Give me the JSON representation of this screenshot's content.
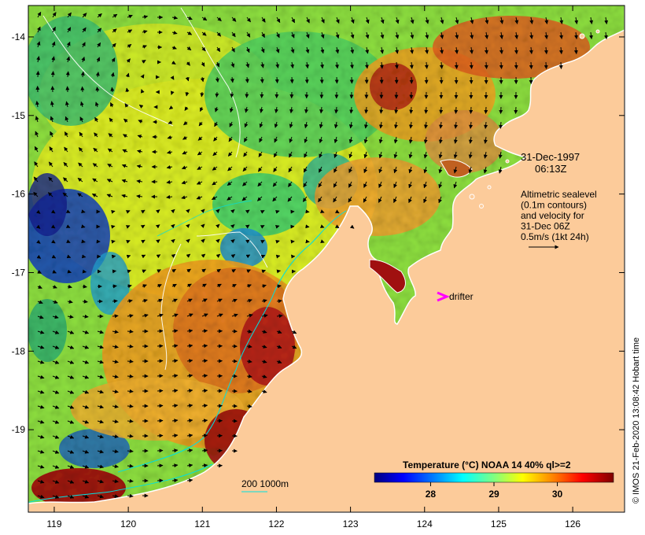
{
  "map": {
    "lon_range": [
      118.65,
      126.7
    ],
    "lat_range": [
      -20.05,
      -13.6
    ],
    "lon_ticks": [
      "119",
      "120",
      "121",
      "122",
      "123",
      "124",
      "125",
      "126"
    ],
    "lat_ticks": [
      "-14",
      "-15",
      "-16",
      "-17",
      "-18",
      "-19"
    ],
    "land_color": "#fccb9a",
    "coast_color": "#ffffff"
  },
  "annotation": {
    "date": "31-Dec-1997",
    "time": "06:13Z",
    "legend_lines": [
      "Altimetric sealevel",
      "(0.1m contours)",
      "and velocity for",
      "31-Dec 06Z",
      "0.5m/s (1kt 24h)"
    ]
  },
  "drifter": {
    "label": "drifter",
    "color": "#ff00ff"
  },
  "depth_contours": {
    "label": "200  1000m",
    "color": "#00e0e0"
  },
  "colorbar": {
    "title": "Temperature (°C) NOAA 14 40% ql>=2",
    "ticks": [
      "28",
      "29",
      "30"
    ],
    "colors": [
      "#00007f",
      "#0000ff",
      "#0080ff",
      "#00ffff",
      "#80ff80",
      "#ffff00",
      "#ff8000",
      "#ff0000",
      "#7f0000"
    ]
  },
  "credit": "© IMOS 21-Feb-2020 13:08:42 Hobart time"
}
